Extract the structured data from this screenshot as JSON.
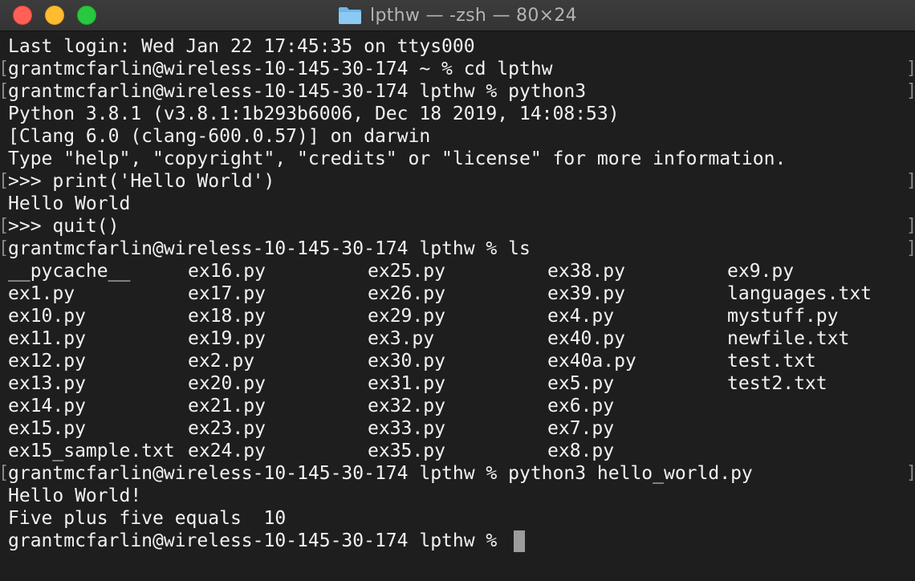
{
  "window": {
    "title": "lpthw — -zsh — 80×24",
    "title_icon": "folder-icon"
  },
  "terminal": {
    "lines": [
      "Last login: Wed Jan 22 17:45:35 on ttys000",
      "grantmcfarlin@wireless-10-145-30-174 ~ % cd lpthw",
      "grantmcfarlin@wireless-10-145-30-174 lpthw % python3",
      "Python 3.8.1 (v3.8.1:1b293b6006, Dec 18 2019, 14:08:53)",
      "[Clang 6.0 (clang-600.0.57)] on darwin",
      "Type \"help\", \"copyright\", \"credits\" or \"license\" for more information.",
      ">>> print('Hello World')",
      "Hello World",
      ">>> quit()",
      "grantmcfarlin@wireless-10-145-30-174 lpthw % ls"
    ],
    "ls_columns": [
      [
        "__pycache__",
        "ex1.py",
        "ex10.py",
        "ex11.py",
        "ex12.py",
        "ex13.py",
        "ex14.py",
        "ex15.py",
        "ex15_sample.txt"
      ],
      [
        "ex16.py",
        "ex17.py",
        "ex18.py",
        "ex19.py",
        "ex2.py",
        "ex20.py",
        "ex21.py",
        "ex23.py",
        "ex24.py"
      ],
      [
        "ex25.py",
        "ex26.py",
        "ex29.py",
        "ex3.py",
        "ex30.py",
        "ex31.py",
        "ex32.py",
        "ex33.py",
        "ex35.py"
      ],
      [
        "ex38.py",
        "ex39.py",
        "ex4.py",
        "ex40.py",
        "ex40a.py",
        "ex5.py",
        "ex6.py",
        "ex7.py",
        "ex8.py"
      ],
      [
        "ex9.py",
        "languages.txt",
        "mystuff.py",
        "newfile.txt",
        "test.txt",
        "test2.txt"
      ]
    ],
    "after_lines": [
      "grantmcfarlin@wireless-10-145-30-174 lpthw % python3 hello_world.py",
      "Hello World!",
      "Five plus five equals  10",
      "grantmcfarlin@wireless-10-145-30-174 lpthw % "
    ],
    "mark_left": "[",
    "mark_right": "]",
    "colors": {
      "background": "#1e1e1e",
      "text": "#f2f2f2",
      "cursor": "#9c9c9c",
      "titlebar": "#383838"
    }
  }
}
